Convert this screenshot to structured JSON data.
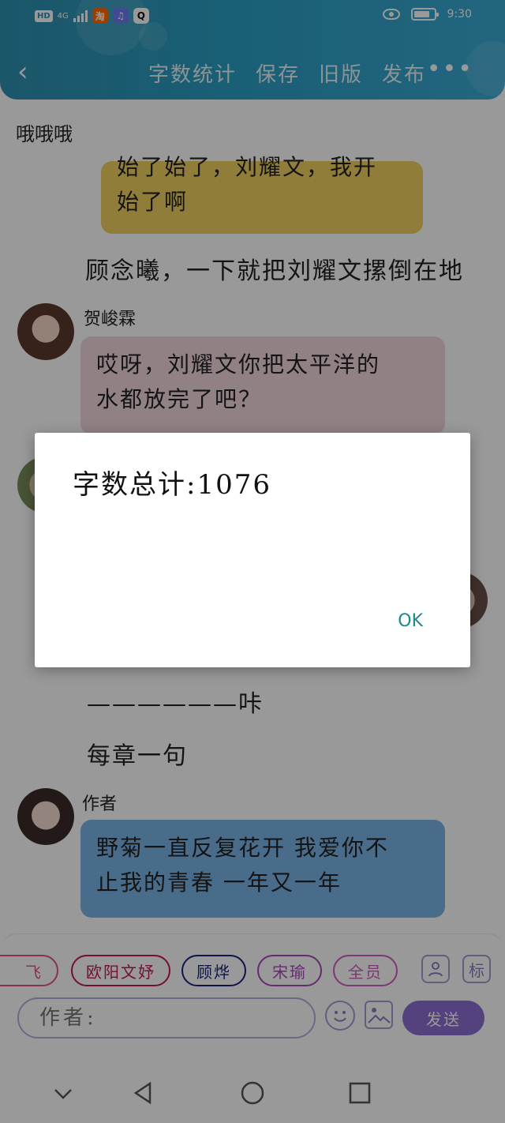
{
  "statusbar": {
    "hd": "HD",
    "network": "4G",
    "time": "9:30",
    "apps": [
      "taobao-icon",
      "music-icon",
      "qq-icon"
    ]
  },
  "header": {
    "actions": [
      "字数统计",
      "保存",
      "旧版",
      "发布"
    ],
    "more": "•••"
  },
  "chat": {
    "title": "哦哦哦",
    "messages": [
      {
        "text": "始了始了，刘耀文，我开始了啊",
        "line1": "始了始了，刘耀文，我开",
        "line2": "始了啊",
        "color": "#f0d060"
      },
      {
        "plain": "顾念曦，一下就把刘耀文摞倒在地"
      },
      {
        "name": "贺峻霖",
        "line1": "哎呀，刘耀文你把太平洋的",
        "line2": "水都放完了吧？",
        "color": "#f2d8dc"
      },
      {
        "plain": "——————咔"
      },
      {
        "plain": "每章一句"
      },
      {
        "name": "作者",
        "line1": "野菊一直反复花开 我爱你不",
        "line2": "止我的青春 一年又一年",
        "color": "#7cb4e8"
      }
    ]
  },
  "chips": [
    {
      "label": "飞",
      "color": "#e0548a"
    },
    {
      "label": "欧阳文妤",
      "color": "#c2185b"
    },
    {
      "label": "顾烨",
      "color": "#1a237e"
    },
    {
      "label": "宋瑜",
      "color": "#ab47bc"
    },
    {
      "label": "全员",
      "color": "#d05cc4"
    }
  ],
  "input": {
    "author_placeholder": "作者:",
    "send_label": "发送",
    "tag_label": "标"
  },
  "dialog": {
    "message": "字数总计:1076",
    "ok_label": "OK"
  }
}
